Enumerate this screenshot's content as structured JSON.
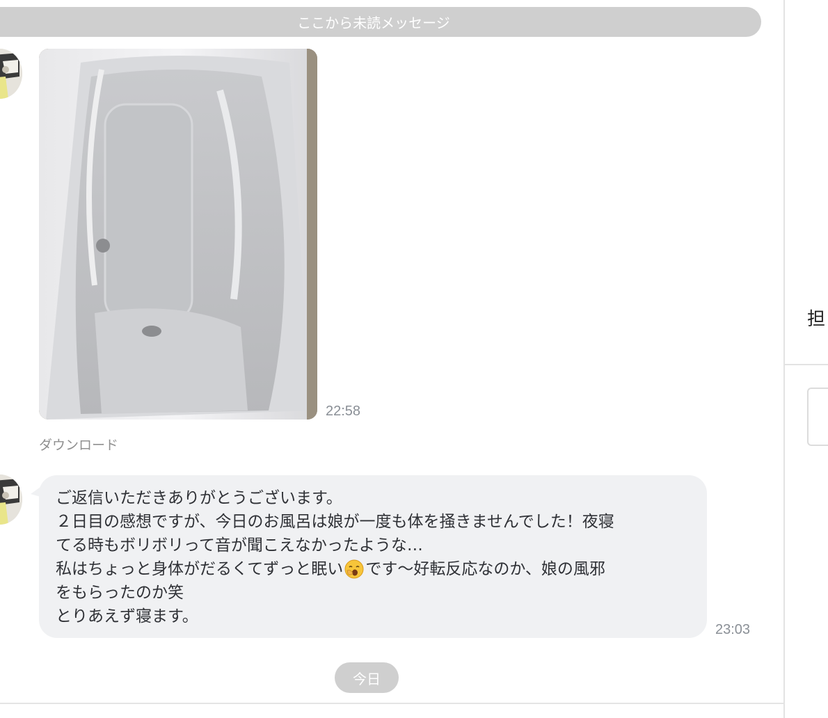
{
  "chat": {
    "unread_divider": "ここから未読メッセージ",
    "messages": [
      {
        "type": "image",
        "time": "22:58",
        "download_label": "ダウンロード"
      },
      {
        "type": "text",
        "time": "23:03",
        "lines": [
          "ご返信いただきありがとうございます。",
          "２日目の感想ですが、今日のお風呂は娘が一度も体を掻きませんでした！夜寝",
          "てる時もボリボリって音が聞こえなかったような…",
          "私はちょっと身体がだるくてずっと眠い",
          "です〜好転反応なのか、娘の風邪",
          "をもらったのか笑",
          "とりあえず寝ます。"
        ],
        "emoji": "yawning-face"
      }
    ],
    "date_badge": "今日"
  },
  "side_panel": {
    "label": "担"
  },
  "colors": {
    "bubble_bg": "#f0f1f3",
    "divider_bg": "#cfcfcf",
    "timestamp": "#8a8f96"
  }
}
